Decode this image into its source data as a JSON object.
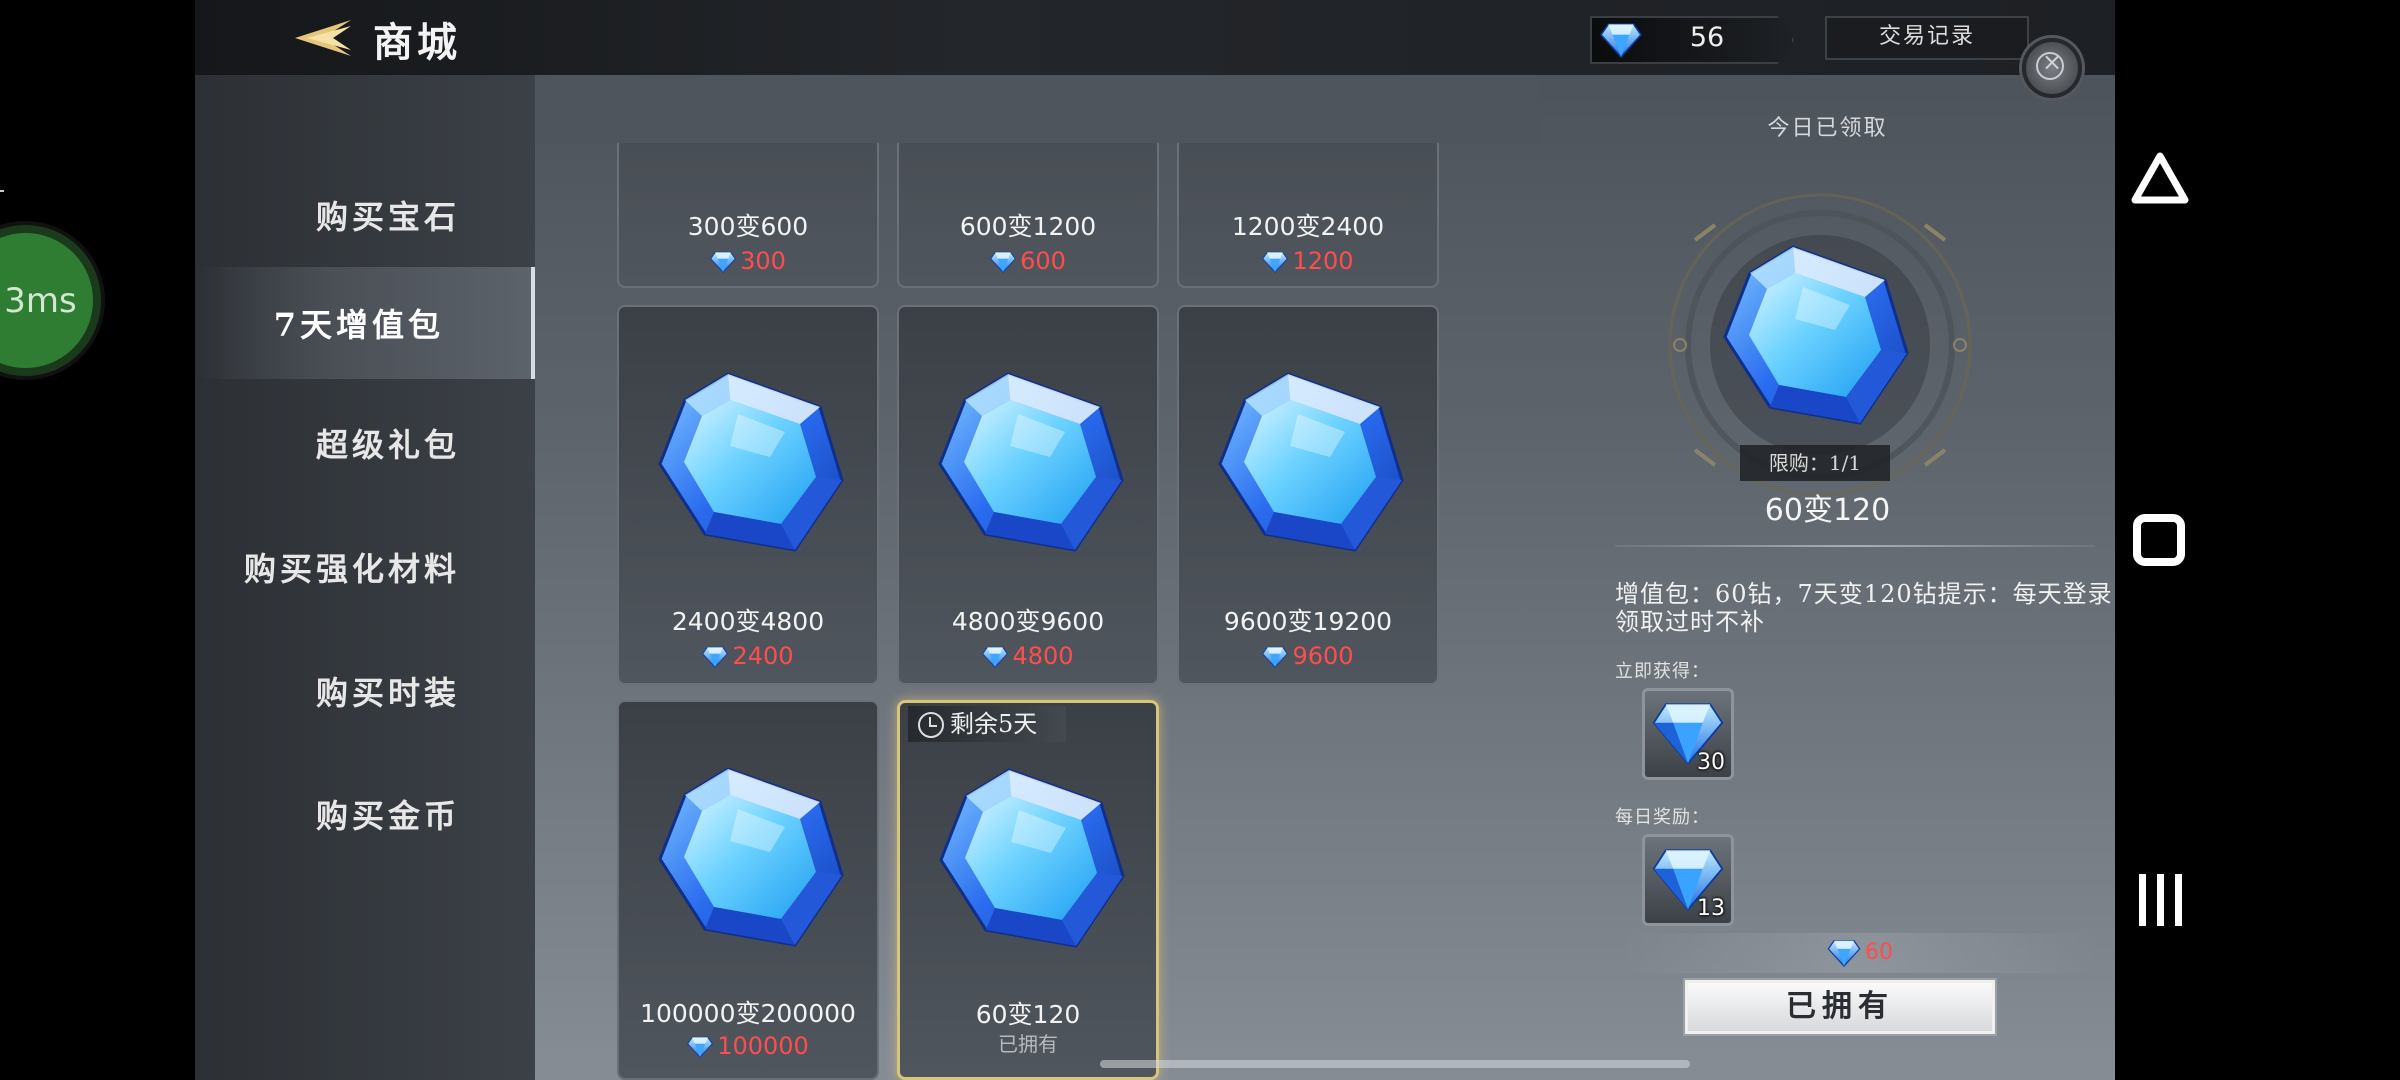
{
  "overlay": {
    "latency": "3ms"
  },
  "header": {
    "back_label": "返回",
    "title": "商城",
    "gem_balance": "56",
    "trade_history_label": "交易记录",
    "close_icon": "×"
  },
  "sidebar": {
    "items": [
      {
        "label": "购买宝石",
        "active": false
      },
      {
        "label": "7天增值包",
        "active": true
      },
      {
        "label": "超级礼包",
        "active": false
      },
      {
        "label": "购买强化材料",
        "active": false
      },
      {
        "label": "购买时装",
        "active": false
      },
      {
        "label": "购买金币",
        "active": false
      }
    ]
  },
  "packages": [
    {
      "name": "300变600",
      "price": "300"
    },
    {
      "name": "600变1200",
      "price": "600"
    },
    {
      "name": "1200变2400",
      "price": "1200"
    },
    {
      "name": "2400变4800",
      "price": "2400"
    },
    {
      "name": "4800变9600",
      "price": "4800"
    },
    {
      "name": "9600变19200",
      "price": "9600"
    },
    {
      "name": "100000变200000",
      "price": "100000"
    },
    {
      "name": "60变120",
      "status": "已拥有",
      "timer": "剩余5天",
      "selected": true
    }
  ],
  "detail": {
    "claimed_today": "今日已领取",
    "limit": "限购：1/1",
    "name": "60变120",
    "description": "增值包：60钻，7天变120钻提示：每天登录领取过时不补",
    "instant_label": "立即获得：",
    "instant_qty": "30",
    "daily_label": "每日奖励：",
    "daily_qty": "13",
    "cost": "60",
    "button_label": "已拥有"
  },
  "colors": {
    "price_red": "#ff4d4d",
    "selected_border": "#d9c47a",
    "gem_blue": "#2f8cff"
  },
  "icons": {
    "gem": "blue-diamond-icon",
    "back": "back-arrow-icon",
    "close": "close-icon",
    "timer": "clock-icon"
  },
  "android": {
    "back": "triangle-back-icon",
    "home": "square-home-icon",
    "recent": "recents-icon"
  }
}
